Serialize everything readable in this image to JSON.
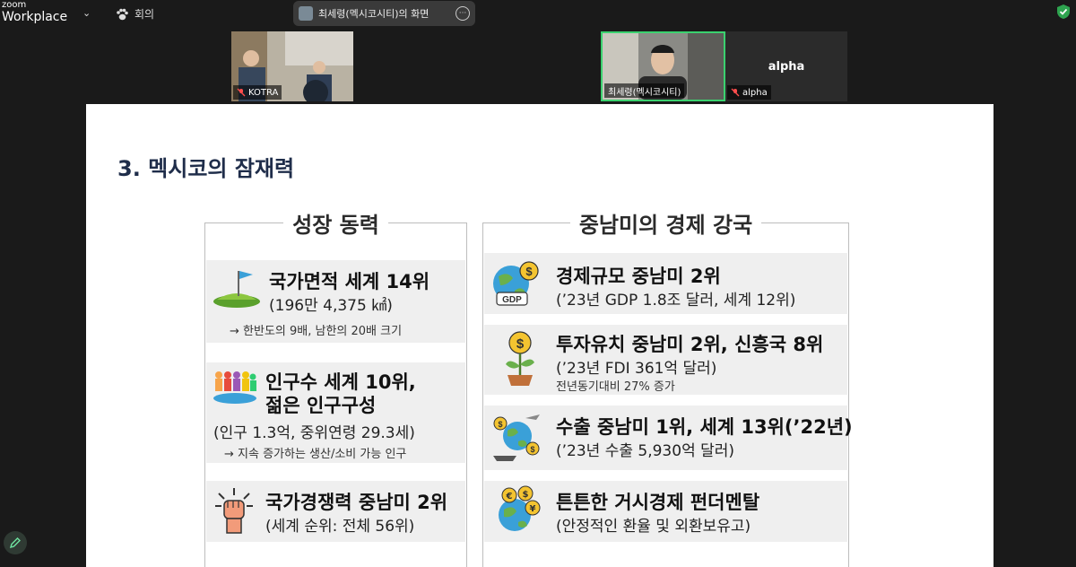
{
  "app": {
    "brand_small": "zoom",
    "brand_big": "Workplace"
  },
  "toolbar": {
    "meeting_label": "회의",
    "share_label": "최세령(멕시코시티)의 화면",
    "share_more": "···"
  },
  "participants": [
    {
      "name": "KOTRA"
    },
    {
      "name": "최세령(멕시코시티)"
    },
    {
      "name": "alpha",
      "display": "alpha"
    }
  ],
  "slide": {
    "title": "3. 멕시코의 잠재력",
    "left": {
      "heading": "성장 동력",
      "items": [
        {
          "main": "국가면적 세계 14위",
          "sub": "(196만 4,375 ㎢)",
          "note": "→ 한반도의 9배, 남한의 20배 크기"
        },
        {
          "main1": "인구수 세계 10위,",
          "main2": "젊은 인구구성",
          "sub": "(인구 1.3억, 중위연령 29.3세)",
          "note": "→ 지속 증가하는 생산/소비 가능 인구"
        },
        {
          "main": "국가경쟁력 중남미 2위",
          "sub": "(세계 순위: 전체 56위)"
        }
      ]
    },
    "right": {
      "heading": "중남미의 경제 강국",
      "items": [
        {
          "main": "경제규모 중남미 2위",
          "sub": "(’23년 GDP 1.8조 달러, 세계 12위)",
          "icon_text": "GDP"
        },
        {
          "main": "투자유치 중남미 2위, 신흥국 8위",
          "sub": "(’23년 FDI 361억 달러)",
          "note": "전년동기대비 27% 증가"
        },
        {
          "main": "수출 중남미 1위, 세계 13위(’22년)",
          "sub": "(’23년 수출 5,930억 달러)"
        },
        {
          "main": "튼튼한 거시경제 펀더멘탈",
          "sub": "(안정적인 환율 및 외환보유고)"
        }
      ]
    }
  },
  "colors": {
    "slide_bg": "#ffffff",
    "card_bg": "#efefef",
    "title": "#1f2d4a",
    "frame_bg": "#1a1a1a",
    "active_speaker": "#3bd16f"
  }
}
